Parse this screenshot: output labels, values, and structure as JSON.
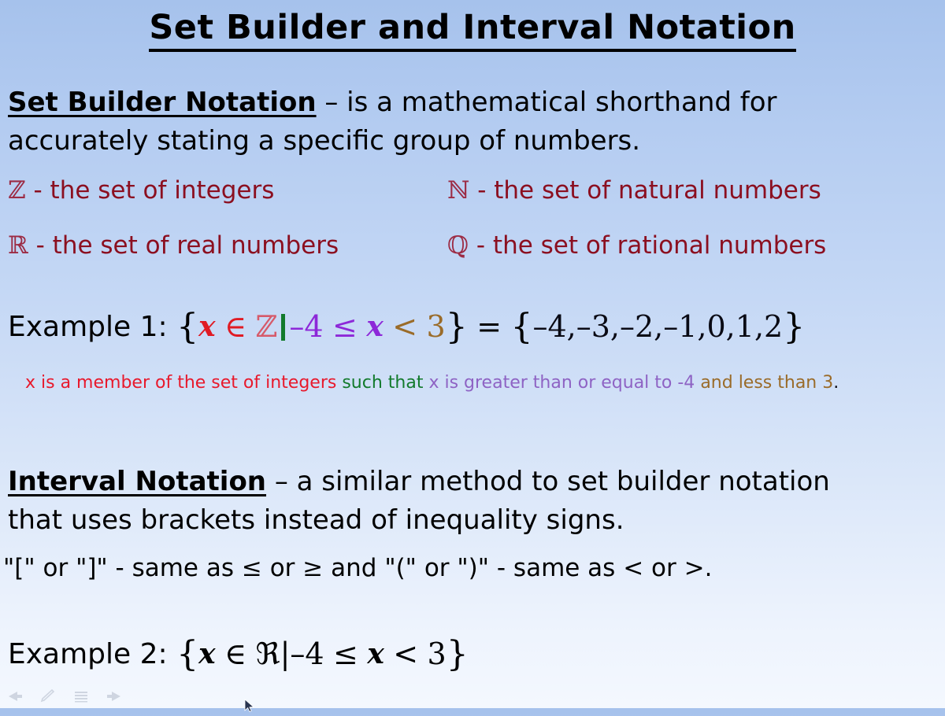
{
  "slide": {
    "title": "Set Builder and Interval Notation",
    "set_builder": {
      "lead": "Set Builder Notation",
      "definition": " – is a mathematical shorthand for accurately stating a specific group of numbers.",
      "symbols": [
        {
          "symbol": "ℤ",
          "symbol_name": "blackboard-bold-Z",
          "description": "- the set of integers"
        },
        {
          "symbol": "ℕ",
          "symbol_name": "blackboard-bold-N",
          "description": "- the set of natural numbers"
        },
        {
          "symbol": "ℝ",
          "symbol_name": "blackboard-bold-R",
          "description": "- the set of real numbers"
        },
        {
          "symbol": "ℚ",
          "symbol_name": "blackboard-bold-Q",
          "description": "- the set of rational numbers"
        }
      ]
    },
    "example1": {
      "label": "Example 1:",
      "open_brace": "{",
      "var1": "x",
      "member": "∈",
      "set_symbol": "ℤ",
      "neg4": "–4",
      "le": "≤",
      "var2": "x",
      "lt": "<",
      "three": "3",
      "close_brace": "}",
      "equals": "=",
      "result_open": "{",
      "result": "–4,–3,–2,–1,0,1,2",
      "result_close": "}",
      "explanation": {
        "part_red": "x is a member of the set of integers",
        "part_green": "such that",
        "part_purple": "x is greater than or equal to -4",
        "part_brown": "and less than 3",
        "period": "."
      }
    },
    "interval": {
      "lead": "Interval Notation",
      "definition": " – a similar method to set builder notation that uses brackets instead of inequality signs.",
      "bracket_rule": {
        "sq_open": "\"[\"",
        "or1": "or",
        "sq_close": "\"]\"",
        "same_as_1": "- same as",
        "le": "≤",
        "or2": "or",
        "ge": "≥",
        "and": "and",
        "pr_open": "\"(\"",
        "or3": "or",
        "pr_close": "\")\"",
        "same_as_2": "- same as",
        "lt": "<",
        "or4": "or",
        "gt": ">",
        "period": "."
      }
    },
    "example2": {
      "label": "Example 2:",
      "open_brace": "{",
      "var1": "x",
      "member": "∈",
      "set_symbol": "ℜ",
      "pipe": "|",
      "neg4": "–4",
      "le": "≤",
      "var2": "x",
      "lt": "<",
      "three": "3",
      "close_brace": "}"
    }
  },
  "toolbar": {
    "items": [
      {
        "name": "previous-slide-arrow-icon"
      },
      {
        "name": "pen-icon"
      },
      {
        "name": "menu-icon"
      },
      {
        "name": "next-slide-arrow-icon"
      }
    ]
  },
  "colors": {
    "background_top": "#a6c2ec",
    "background_bottom": "#f4f8fe",
    "set_text": "#8b0f20",
    "accent_red": "#e01b24",
    "accent_green": "#127a2c",
    "accent_purple": "#8d28d8",
    "accent_brown": "#9a6b29"
  }
}
